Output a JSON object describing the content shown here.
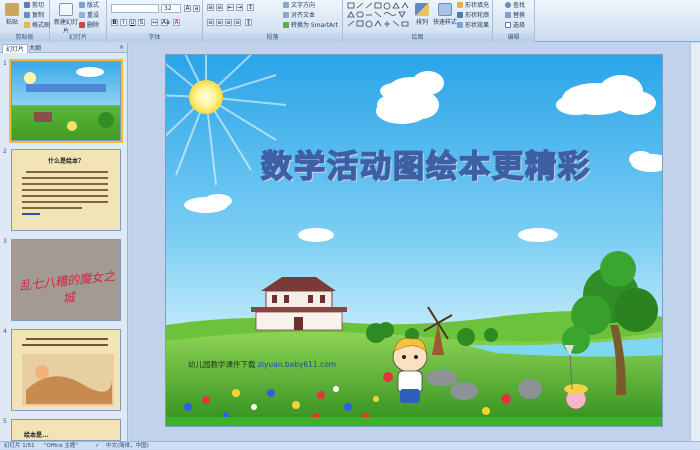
{
  "ribbon": {
    "clipboard": {
      "label": "剪贴板",
      "paste": "粘贴",
      "cut": "剪切",
      "copy": "复制",
      "format_painter": "格式刷"
    },
    "slides": {
      "label": "幻灯片",
      "new_slide": "新建幻灯片",
      "layout": "版式",
      "reset": "重设",
      "delete": "删除"
    },
    "font": {
      "label": "字体",
      "font_size": "32"
    },
    "paragraph": {
      "label": "段落",
      "text_direction": "文字方向",
      "align_text": "对齐文本",
      "smartart": "转换为 SmartArt"
    },
    "drawing": {
      "label": "绘图",
      "arrange": "排列",
      "quick_styles": "快速样式",
      "shape_fill": "形状填充",
      "shape_outline": "形状轮廓",
      "shape_effects": "形状效果"
    },
    "editing": {
      "label": "编辑",
      "find": "查找",
      "replace": "替换",
      "select": "选择"
    }
  },
  "left_panel": {
    "tabs": [
      "幻灯片",
      "大纲"
    ],
    "slides": [
      {
        "num": "1",
        "selected": true
      },
      {
        "num": "2",
        "title": "什么是绘本？"
      },
      {
        "num": "3",
        "title": "乱七八糟的魔女之城"
      },
      {
        "num": "4"
      },
      {
        "num": "5",
        "title": "绘本是..."
      }
    ]
  },
  "slide": {
    "title": "数学活动图绘本更精彩",
    "footer_label": "幼儿园教学课件下载",
    "footer_url": "ziyuan.baby611.com"
  },
  "status": {
    "slide_indicator": "幻灯片 1/51",
    "theme": "\"Office 主题\"",
    "language": "中文(简体，中国)"
  },
  "colors": {
    "ribbon_bg": "#d6e4f4",
    "sky_top": "#2ea6e8",
    "grass": "#4caf2a",
    "title_fill": "#6a8fc8"
  }
}
